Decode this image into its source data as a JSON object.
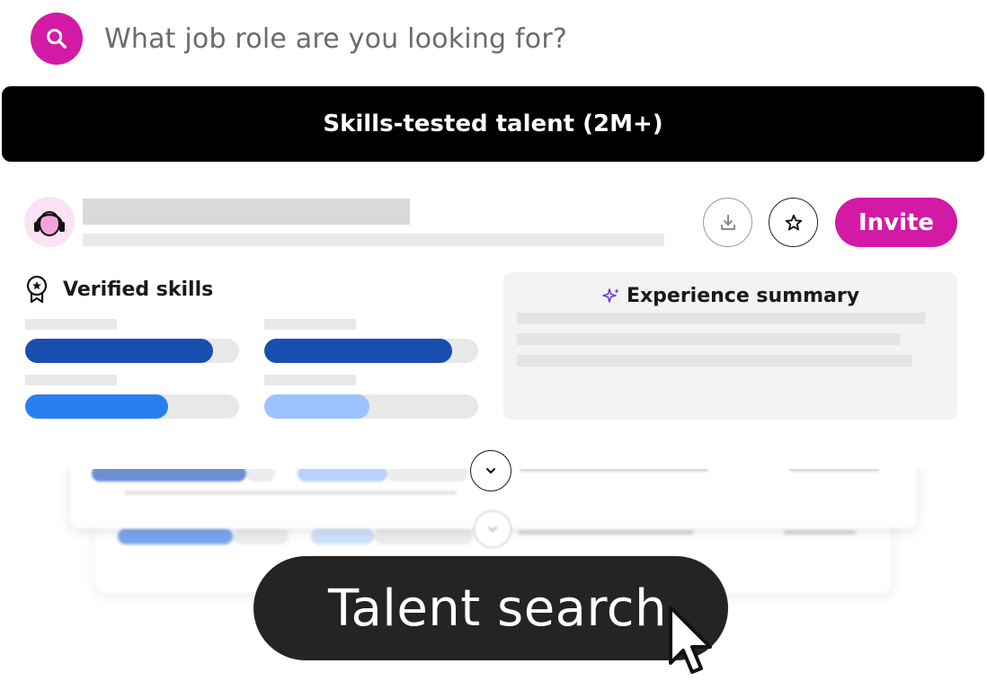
{
  "search": {
    "placeholder": "What job role are you looking for?",
    "icon": "search-icon",
    "accent_color": "#d21aa6"
  },
  "banner": {
    "label": "Skills-tested talent (2M+)"
  },
  "candidate_card": {
    "actions": {
      "download_icon": "download-icon",
      "star_icon": "star-icon",
      "invite_label": "Invite"
    },
    "verified_skills": {
      "label": "Verified skills",
      "icon": "badge-icon",
      "skills": [
        {
          "level": 0.88,
          "color": "#1a4db0"
        },
        {
          "level": 0.88,
          "color": "#1a4db0"
        },
        {
          "level": 0.67,
          "color": "#2a7ff0"
        },
        {
          "level": 0.49,
          "color": "#9cc3ff"
        }
      ]
    },
    "experience_summary": {
      "label": "Experience summary",
      "icon": "sparkle-icon"
    }
  },
  "talent_search": {
    "label": "Talent search"
  }
}
